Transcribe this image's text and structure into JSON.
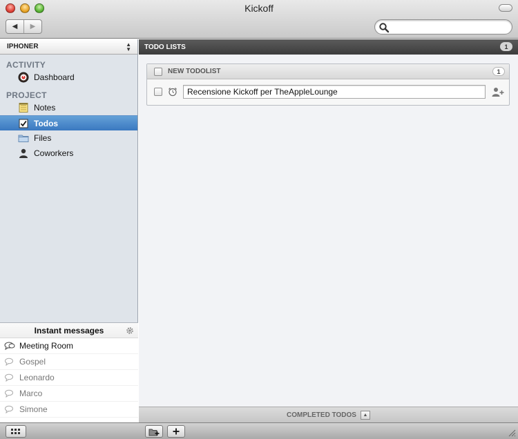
{
  "window": {
    "title": "Kickoff"
  },
  "toolbar": {
    "back_glyph": "◀",
    "forward_glyph": "▶",
    "search": {
      "value": "",
      "placeholder": ""
    }
  },
  "sidebar": {
    "project_selector": "IPHONER",
    "sections": [
      {
        "title": "ACTIVITY",
        "items": [
          {
            "label": "Dashboard",
            "icon": "dashboard-icon"
          }
        ]
      },
      {
        "title": "PROJECT",
        "items": [
          {
            "label": "Notes",
            "icon": "notes-icon"
          },
          {
            "label": "Todos",
            "icon": "todos-icon",
            "selected": true
          },
          {
            "label": "Files",
            "icon": "folder-icon"
          },
          {
            "label": "Coworkers",
            "icon": "person-icon"
          }
        ]
      }
    ],
    "instant_messages": {
      "title": "Instant messages",
      "items": [
        {
          "label": "Meeting Room",
          "active": true
        },
        {
          "label": "Gospel"
        },
        {
          "label": "Leonardo"
        },
        {
          "label": "Marco"
        },
        {
          "label": "Simone"
        }
      ]
    }
  },
  "main": {
    "header": {
      "title": "TODO LISTS",
      "count": "1"
    },
    "todolist": {
      "title": "NEW TODOLIST",
      "count": "1",
      "items": [
        {
          "text": "Recensione Kickoff per TheAppleLounge",
          "done": false
        }
      ]
    },
    "completed_label": "COMPLETED TODOS"
  },
  "colors": {
    "selection": "#3a78c0",
    "header_dark": "#3c3c3c",
    "sidebar_bg": "#dfe4ea"
  }
}
